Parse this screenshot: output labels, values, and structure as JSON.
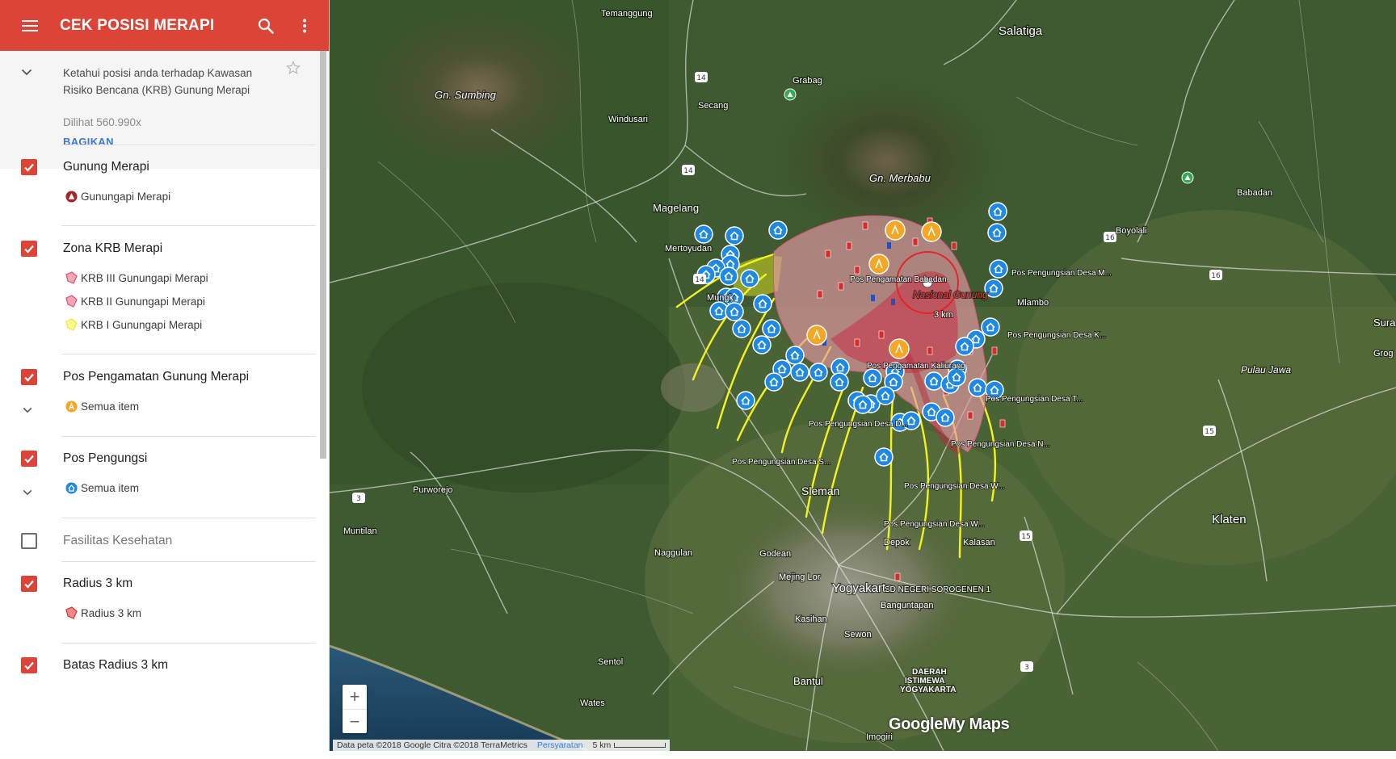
{
  "app": {
    "title": "CEK POSISI MERAPI",
    "description": "Ketahui posisi anda terhadap Kawasan Risiko Bencana (KRB) Gunung Merapi",
    "views": "Dilihat 560.990x",
    "share_label": "BAGIKAN"
  },
  "layers": [
    {
      "title": "Gunung Merapi",
      "checked": true,
      "items": [
        {
          "icon": "volcano-icon",
          "label": "Gunungapi Merapi"
        }
      ]
    },
    {
      "title": "Zona KRB Merapi",
      "checked": true,
      "items": [
        {
          "icon": "polygon-pink-icon",
          "label": "KRB III Gunungapi Merapi"
        },
        {
          "icon": "polygon-pink-icon",
          "label": "KRB II Gunungapi Merapi"
        },
        {
          "icon": "polygon-yellow-icon",
          "label": "KRB I Gunungapi Merapi"
        }
      ]
    },
    {
      "title": "Pos Pengamatan Gunung Merapi",
      "checked": true,
      "items": [
        {
          "icon": "observation-post-icon",
          "label": "Semua item"
        }
      ]
    },
    {
      "title": "Pos Pengungsi",
      "checked": true,
      "items": [
        {
          "icon": "shelter-icon",
          "label": "Semua item"
        }
      ]
    },
    {
      "title": "Fasilitas Kesehatan",
      "checked": false,
      "items": []
    },
    {
      "title": "Radius 3 km",
      "checked": true,
      "items": [
        {
          "icon": "polygon-red-icon",
          "label": "Radius 3 km"
        }
      ]
    },
    {
      "title": "Batas Radius 3 km",
      "checked": true,
      "items": []
    }
  ],
  "colors": {
    "accent": "#db4437",
    "link": "#3b78d8",
    "krb_pink": "#e79aa7",
    "krb_red": "#c8374a",
    "krb_yellow": "#f3f31c",
    "shelter_blue": "#1e88e5",
    "post_orange": "#f5a623"
  },
  "map": {
    "labels": {
      "temanggung": "Temanggung",
      "salatiga": "Salatiga",
      "sumbing": "Gn. Sumbing",
      "grabag": "Grabag",
      "secang": "Secang",
      "windusari": "Windusari",
      "merbabu": "Gn. Merbabu",
      "babadan_town": "Babadan",
      "magelang": "Magelang",
      "mertoyudan": "Mertoyudan",
      "boyolali": "Boyolali",
      "mungkid": "Mungk",
      "mlambo": "Mlambo",
      "sura": "Sura",
      "grog": "Grog",
      "pulau_jawa": "Pulau Jawa",
      "purworejo": "Purworejo",
      "muntilan": "Muntilan",
      "sleman": "Sleman",
      "klaten": "Klaten",
      "naggulan": "Naggulan",
      "godean": "Godean",
      "depok": "Depok",
      "kalasan": "Kalasan",
      "mejing_lor": "Mejing Lor",
      "yogyakarta": "Yogyakarta",
      "sd_negeri": "SD NEGERI SOROGENEN 1",
      "banguntapan": "Banguntapan",
      "kasihan": "Kasihan",
      "sewon": "Sewon",
      "sentol": "Sentol",
      "bantul": "Bantul",
      "diy1": "DAERAH",
      "diy2": "ISTIMEWA",
      "diy3": "YOGYAKARTA",
      "wates": "Wates",
      "imogiri": "Imogiri",
      "pos_babadan": "Pos Pengamatan Babadan",
      "taman_nasional": "Nasional Gunung",
      "radius_label": "3 km",
      "pos_kaliurang": "Pos Pengamatan Kaliurang",
      "pos_desa_m": "Pos Pengungsian Desa M...",
      "pos_desa_k": "Pos Pengungsian Desa K...",
      "pos_desa_t": "Pos Pengungsian Desa T...",
      "pos_desa_d": "Pos Pengungsian Desa D...",
      "pos_desa_n": "Pos Pengungsian Desa N...",
      "pos_desa_s": "Pos Pengungsian Desa S...",
      "pos_desa_w1": "Pos Pengungsian Desa W...",
      "pos_desa_w2": "Pos Pengungsian Desa W..."
    },
    "road_numbers": {
      "r14a": "14",
      "r14b": "14",
      "r14c": "14",
      "r16a": "16",
      "r16b": "16",
      "r3a": "3",
      "r3b": "3",
      "r15a": "15",
      "r15b": "15"
    },
    "zoom_in": "+",
    "zoom_out": "−",
    "attribution": "Data peta ©2018 Google Citra ©2018 TerraMetrics",
    "terms": "Persyaratan",
    "scale": "5 km",
    "logo_google": "Google",
    "logo_mymaps": "My Maps"
  }
}
